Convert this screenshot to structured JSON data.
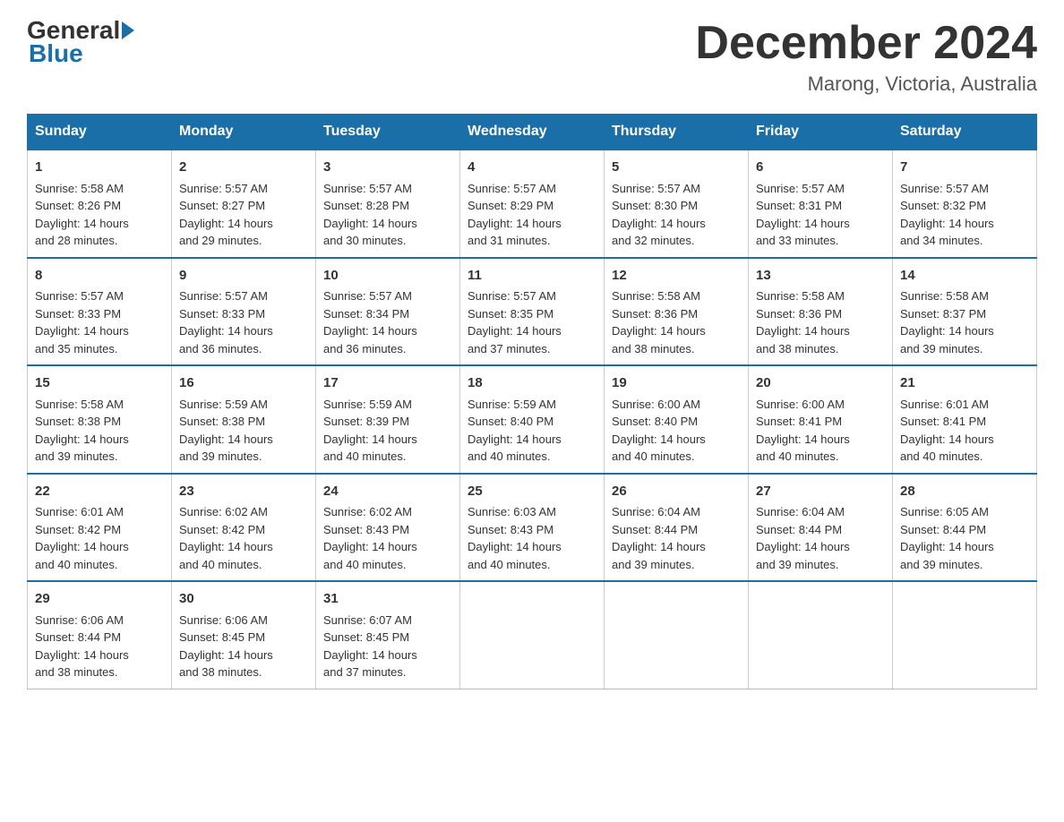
{
  "header": {
    "logo_general": "General",
    "logo_blue": "Blue",
    "month_title": "December 2024",
    "location": "Marong, Victoria, Australia"
  },
  "days_of_week": [
    "Sunday",
    "Monday",
    "Tuesday",
    "Wednesday",
    "Thursday",
    "Friday",
    "Saturday"
  ],
  "weeks": [
    [
      {
        "day": "1",
        "sunrise": "5:58 AM",
        "sunset": "8:26 PM",
        "daylight": "14 hours and 28 minutes."
      },
      {
        "day": "2",
        "sunrise": "5:57 AM",
        "sunset": "8:27 PM",
        "daylight": "14 hours and 29 minutes."
      },
      {
        "day": "3",
        "sunrise": "5:57 AM",
        "sunset": "8:28 PM",
        "daylight": "14 hours and 30 minutes."
      },
      {
        "day": "4",
        "sunrise": "5:57 AM",
        "sunset": "8:29 PM",
        "daylight": "14 hours and 31 minutes."
      },
      {
        "day": "5",
        "sunrise": "5:57 AM",
        "sunset": "8:30 PM",
        "daylight": "14 hours and 32 minutes."
      },
      {
        "day": "6",
        "sunrise": "5:57 AM",
        "sunset": "8:31 PM",
        "daylight": "14 hours and 33 minutes."
      },
      {
        "day": "7",
        "sunrise": "5:57 AM",
        "sunset": "8:32 PM",
        "daylight": "14 hours and 34 minutes."
      }
    ],
    [
      {
        "day": "8",
        "sunrise": "5:57 AM",
        "sunset": "8:33 PM",
        "daylight": "14 hours and 35 minutes."
      },
      {
        "day": "9",
        "sunrise": "5:57 AM",
        "sunset": "8:33 PM",
        "daylight": "14 hours and 36 minutes."
      },
      {
        "day": "10",
        "sunrise": "5:57 AM",
        "sunset": "8:34 PM",
        "daylight": "14 hours and 36 minutes."
      },
      {
        "day": "11",
        "sunrise": "5:57 AM",
        "sunset": "8:35 PM",
        "daylight": "14 hours and 37 minutes."
      },
      {
        "day": "12",
        "sunrise": "5:58 AM",
        "sunset": "8:36 PM",
        "daylight": "14 hours and 38 minutes."
      },
      {
        "day": "13",
        "sunrise": "5:58 AM",
        "sunset": "8:36 PM",
        "daylight": "14 hours and 38 minutes."
      },
      {
        "day": "14",
        "sunrise": "5:58 AM",
        "sunset": "8:37 PM",
        "daylight": "14 hours and 39 minutes."
      }
    ],
    [
      {
        "day": "15",
        "sunrise": "5:58 AM",
        "sunset": "8:38 PM",
        "daylight": "14 hours and 39 minutes."
      },
      {
        "day": "16",
        "sunrise": "5:59 AM",
        "sunset": "8:38 PM",
        "daylight": "14 hours and 39 minutes."
      },
      {
        "day": "17",
        "sunrise": "5:59 AM",
        "sunset": "8:39 PM",
        "daylight": "14 hours and 40 minutes."
      },
      {
        "day": "18",
        "sunrise": "5:59 AM",
        "sunset": "8:40 PM",
        "daylight": "14 hours and 40 minutes."
      },
      {
        "day": "19",
        "sunrise": "6:00 AM",
        "sunset": "8:40 PM",
        "daylight": "14 hours and 40 minutes."
      },
      {
        "day": "20",
        "sunrise": "6:00 AM",
        "sunset": "8:41 PM",
        "daylight": "14 hours and 40 minutes."
      },
      {
        "day": "21",
        "sunrise": "6:01 AM",
        "sunset": "8:41 PM",
        "daylight": "14 hours and 40 minutes."
      }
    ],
    [
      {
        "day": "22",
        "sunrise": "6:01 AM",
        "sunset": "8:42 PM",
        "daylight": "14 hours and 40 minutes."
      },
      {
        "day": "23",
        "sunrise": "6:02 AM",
        "sunset": "8:42 PM",
        "daylight": "14 hours and 40 minutes."
      },
      {
        "day": "24",
        "sunrise": "6:02 AM",
        "sunset": "8:43 PM",
        "daylight": "14 hours and 40 minutes."
      },
      {
        "day": "25",
        "sunrise": "6:03 AM",
        "sunset": "8:43 PM",
        "daylight": "14 hours and 40 minutes."
      },
      {
        "day": "26",
        "sunrise": "6:04 AM",
        "sunset": "8:44 PM",
        "daylight": "14 hours and 39 minutes."
      },
      {
        "day": "27",
        "sunrise": "6:04 AM",
        "sunset": "8:44 PM",
        "daylight": "14 hours and 39 minutes."
      },
      {
        "day": "28",
        "sunrise": "6:05 AM",
        "sunset": "8:44 PM",
        "daylight": "14 hours and 39 minutes."
      }
    ],
    [
      {
        "day": "29",
        "sunrise": "6:06 AM",
        "sunset": "8:44 PM",
        "daylight": "14 hours and 38 minutes."
      },
      {
        "day": "30",
        "sunrise": "6:06 AM",
        "sunset": "8:45 PM",
        "daylight": "14 hours and 38 minutes."
      },
      {
        "day": "31",
        "sunrise": "6:07 AM",
        "sunset": "8:45 PM",
        "daylight": "14 hours and 37 minutes."
      },
      null,
      null,
      null,
      null
    ]
  ],
  "labels": {
    "sunrise": "Sunrise:",
    "sunset": "Sunset:",
    "daylight": "Daylight:"
  }
}
